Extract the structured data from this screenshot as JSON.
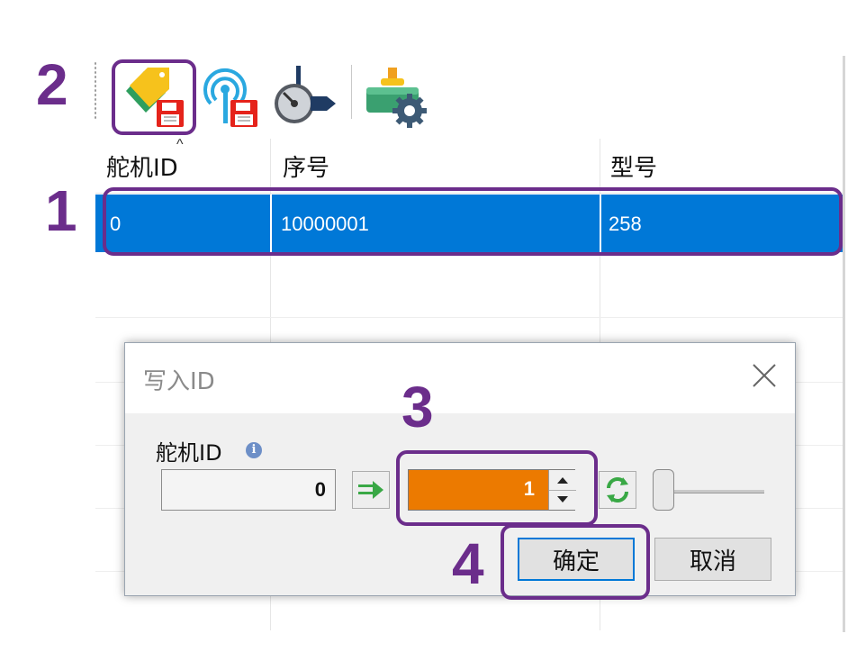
{
  "toolbar": {
    "buttons": [
      {
        "name": "write-id-button",
        "icon": "tag-save-icon"
      },
      {
        "name": "write-wireless-button",
        "icon": "antenna-save-icon"
      },
      {
        "name": "servo-calibrate-button",
        "icon": "servo-horn-icon"
      },
      {
        "name": "servo-settings-button",
        "icon": "motor-gear-icon"
      }
    ]
  },
  "grid": {
    "columns": [
      "舵机ID",
      "序号",
      "型号"
    ],
    "sort_indicator": "^",
    "rows": [
      {
        "id": "0",
        "serial": "10000001",
        "model": "258",
        "selected": true
      }
    ]
  },
  "dialog": {
    "title": "写入ID",
    "field_label": "舵机ID",
    "current_value": "0",
    "new_value": "1",
    "ok_label": "确定",
    "cancel_label": "取消"
  },
  "annotations": [
    "1",
    "2",
    "3",
    "4"
  ],
  "colors": {
    "selection": "#0078d7",
    "new_value_bg": "#ec7a00",
    "annotation": "#6b2d8b"
  }
}
